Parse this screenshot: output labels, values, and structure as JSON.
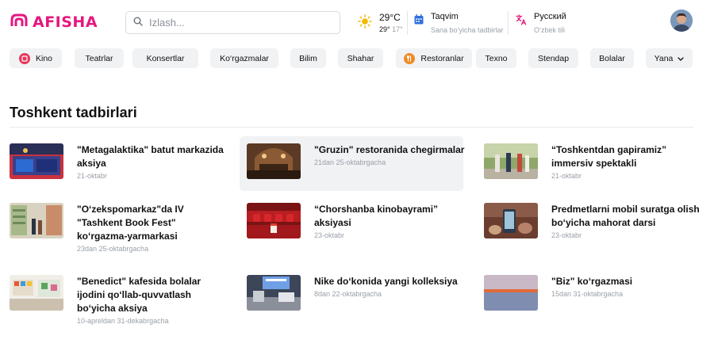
{
  "header": {
    "logo": {
      "text": "AFISHA",
      "icon": "afisha-logo-icon"
    },
    "search": {
      "placeholder": "Izlash...",
      "value": "",
      "icon": "search-icon"
    },
    "weather": {
      "icon": "sun-icon",
      "current": "29°C",
      "high": "29°",
      "low": "17°"
    },
    "calendar": {
      "icon": "calendar-icon",
      "title": "Taqvim",
      "subtitle": "Sana bo‘yicha tadbirlar"
    },
    "language": {
      "icon": "translate-icon",
      "title": "Русский",
      "subtitle": "O‘zbek tili"
    },
    "avatar": {
      "icon": "avatar"
    }
  },
  "categories": [
    {
      "label": "Kino",
      "icon": "film-icon"
    },
    {
      "label": "Teatrlar"
    },
    {
      "label": "Konsertlar"
    },
    {
      "label": "Ko‘rgazmalar"
    },
    {
      "label": "Bilim"
    },
    {
      "label": "Shahar"
    },
    {
      "label": "Restoranlar",
      "icon": "fork-knife-icon"
    },
    {
      "label": "Texno"
    },
    {
      "label": "Stendap"
    },
    {
      "label": "Bolalar"
    },
    {
      "label": "Yana",
      "icon": "chevron-down-icon"
    }
  ],
  "section": {
    "title": "Toshkent tadbirlari"
  },
  "events": [
    {
      "title": "\"Metagalaktika\" batut markazida aksiya",
      "date": "21-oktabr"
    },
    {
      "title": "\"Gruzin\" restoranida chegirmalar",
      "date": "21dan 25-oktabrgacha"
    },
    {
      "title": "“Toshkentdan gapiramiz” immersiv spektakli",
      "date": "21-oktabr"
    },
    {
      "title": "\"O‘zekspomarkaz\"da IV \"Tashkent Book Fest\" ko‘rgazma-yarmarkasi",
      "date": "23dan 25-oktabrgacha"
    },
    {
      "title": "“Chorshanba kinobayrami” aksiyasi",
      "date": "23-oktabr"
    },
    {
      "title": "Predmetlarni mobil suratga olish bo‘yicha mahorat darsi",
      "date": "23-oktabr"
    },
    {
      "title": "\"Benedict\" kafesida bolalar ijodini qo‘llab-quvvatlash bo‘yicha aksiya",
      "date": "10-apreldan 31-dekabrgacha"
    },
    {
      "title": "Nike do‘konida yangi kolleksiya",
      "date": "8dan 22-oktabrgacha"
    },
    {
      "title": "\"Biz\" ko‘rgazmasi",
      "date": "15dan 31-oktabrgacha"
    }
  ],
  "colors": {
    "brand": "#e5177f",
    "chip_bg": "#f1f2f4",
    "muted": "#9aa0a8",
    "kino_icon": "#e8365d",
    "restoran_icon": "#f08a24",
    "calendar_icon": "#2f6fe0",
    "translate_icon": "#e5177f"
  }
}
